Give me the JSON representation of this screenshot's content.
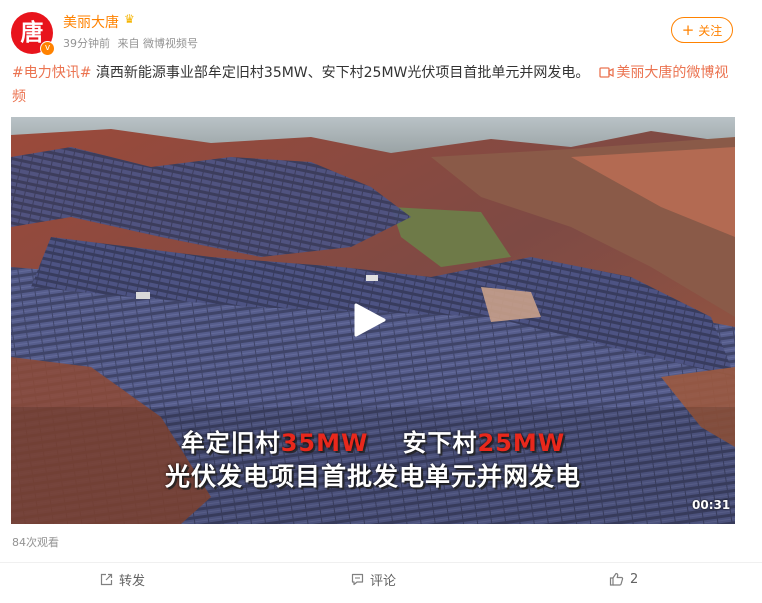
{
  "author": {
    "name": "美丽大唐",
    "avatar_char": "唐",
    "verified_badge": "v",
    "badge_icon": "crown-icon"
  },
  "meta": {
    "time": "39分钟前",
    "source": "来自 微博视频号"
  },
  "follow": {
    "icon": "+",
    "label": "关注"
  },
  "post": {
    "hashtag": "#电力快讯#",
    "text": " 滇西新能源事业部牟定旧村35MW、安下村25MW光伏项目首批单元并网发电。",
    "video_link_icon": "video-icon",
    "video_link_label": "美丽大唐的微博视频"
  },
  "video": {
    "caption_line1": {
      "a": "牟定旧村",
      "a_mw": "35MW",
      "b": "安下村",
      "b_mw": "25MW"
    },
    "caption_line2": "光伏发电项目首批发电单元并网发电",
    "duration": "00:31"
  },
  "views": "84次观看",
  "actions": {
    "repost": "转发",
    "comment": "评论",
    "like_count": "2"
  },
  "colors": {
    "accent": "#ff8200",
    "link": "#eb7350",
    "brand_red": "#e8141c",
    "caption_red": "#e8281c"
  }
}
